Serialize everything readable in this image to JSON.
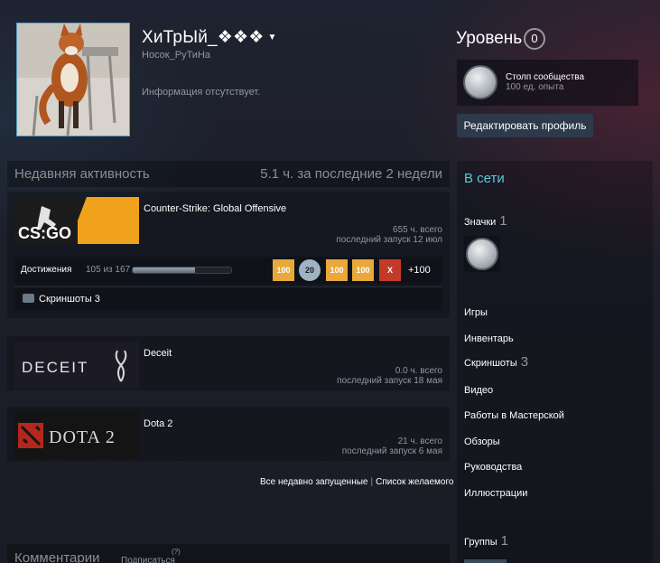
{
  "profile": {
    "persona_name": "ХиТрЫй_❖❖❖",
    "real_name": "Носок_РуТиНа",
    "summary": "Информация отсутствует."
  },
  "level": {
    "label": "Уровень",
    "value": "0"
  },
  "favorite_badge": {
    "name": "Столп сообщества",
    "xp": "100 ед. опыта"
  },
  "edit_profile_label": "Редактировать профиль",
  "recent_activity": {
    "title": "Недавняя активность",
    "hours_value": "5.1",
    "hours_mid": " ч. за последние ",
    "hours_weeks": "2",
    "hours_suffix": " недели"
  },
  "games": [
    {
      "name": "Counter-Strike: Global Offensive",
      "logo_text": "CS:GO",
      "hours_total": "655 ч. всего",
      "last_played": "последний запуск 12 июл",
      "achievements_label": "Достижения",
      "achievements_count": "105 из 167",
      "achievements_progress": 0.63,
      "achievement_icons": [
        "100",
        "20",
        "100",
        "100",
        "X"
      ],
      "achievements_more": "+100",
      "screenshots_label": "Скриншоты 3"
    },
    {
      "name": "Deceit",
      "logo_text": "DECEIT",
      "hours_total": "0.0 ч. всего",
      "last_played": "последний запуск 18 мая"
    },
    {
      "name": "Dota 2",
      "logo_text": "DOTA 2",
      "hours_total": "21 ч. всего",
      "last_played": "последний запуск 6 мая"
    }
  ],
  "links": {
    "all_recent": "Все недавно запущенные",
    "separator": "|",
    "wishlist": "Список желаемого"
  },
  "comments": {
    "title": "Комментарии",
    "subscribe": "Подписаться",
    "superscript": "(?)"
  },
  "sidebar": {
    "status": "В сети",
    "badges_label": "Значки",
    "badges_count": "1",
    "items": [
      {
        "label": "Игры",
        "count": ""
      },
      {
        "label": "Инвентарь",
        "count": ""
      },
      {
        "label": "Скриншоты",
        "count": "3"
      },
      {
        "label": "Видео",
        "count": ""
      },
      {
        "label": "Работы в Мастерской",
        "count": ""
      },
      {
        "label": "Обзоры",
        "count": ""
      },
      {
        "label": "Руководства",
        "count": ""
      },
      {
        "label": "Иллюстрации",
        "count": ""
      }
    ],
    "groups_label": "Группы",
    "groups_count": "1"
  },
  "colors": {
    "accent_online": "#57cbde",
    "background": "#1d2029",
    "button": "#2c3a4c"
  }
}
